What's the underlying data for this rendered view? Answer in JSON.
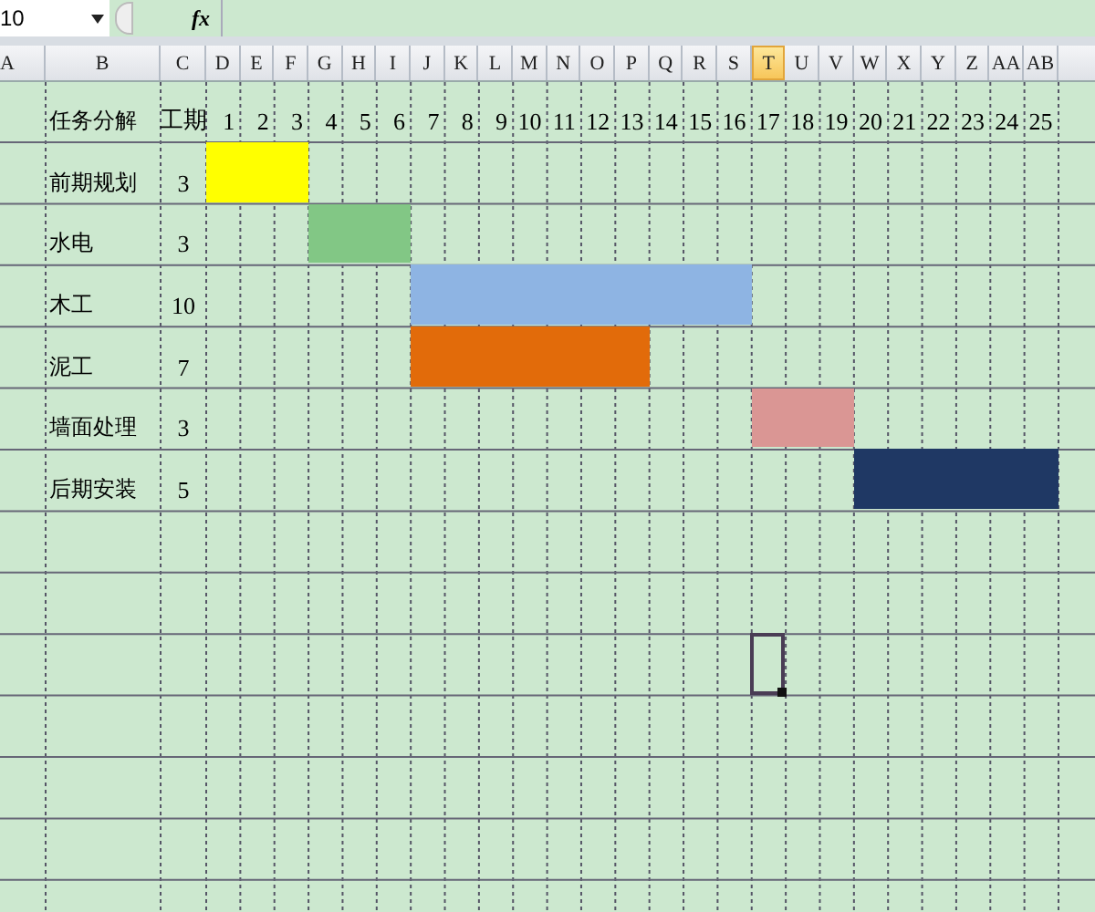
{
  "formula_bar": {
    "name_box": "10",
    "fx": "fx"
  },
  "columns": [
    {
      "label": "A",
      "selected": false
    },
    {
      "label": "B",
      "selected": false
    },
    {
      "label": "C",
      "selected": false
    },
    {
      "label": "D",
      "selected": false
    },
    {
      "label": "E",
      "selected": false
    },
    {
      "label": "F",
      "selected": false
    },
    {
      "label": "G",
      "selected": false
    },
    {
      "label": "H",
      "selected": false
    },
    {
      "label": "I",
      "selected": false
    },
    {
      "label": "J",
      "selected": false
    },
    {
      "label": "K",
      "selected": false
    },
    {
      "label": "L",
      "selected": false
    },
    {
      "label": "M",
      "selected": false
    },
    {
      "label": "N",
      "selected": false
    },
    {
      "label": "O",
      "selected": false
    },
    {
      "label": "P",
      "selected": false
    },
    {
      "label": "Q",
      "selected": false
    },
    {
      "label": "R",
      "selected": false
    },
    {
      "label": "S",
      "selected": false
    },
    {
      "label": "T",
      "selected": true
    },
    {
      "label": "U",
      "selected": false
    },
    {
      "label": "V",
      "selected": false
    },
    {
      "label": "W",
      "selected": false
    },
    {
      "label": "X",
      "selected": false
    },
    {
      "label": "Y",
      "selected": false
    },
    {
      "label": "Z",
      "selected": false
    },
    {
      "label": "AA",
      "selected": false
    },
    {
      "label": "AB",
      "selected": false
    }
  ],
  "header_row": {
    "task": "任务分解",
    "duration": "工期",
    "days": [
      "1",
      "2",
      "3",
      "4",
      "5",
      "6",
      "7",
      "8",
      "9",
      "10",
      "11",
      "12",
      "13",
      "14",
      "15",
      "16",
      "17",
      "18",
      "19",
      "20",
      "21",
      "22",
      "23",
      "24",
      "25"
    ]
  },
  "tasks": [
    {
      "name": "前期规划",
      "duration": "3",
      "color": "#ffff00",
      "filled": [
        true,
        true,
        true,
        false,
        false,
        false,
        false,
        false,
        false,
        false,
        false,
        false,
        false,
        false,
        false,
        false,
        false,
        false,
        false,
        false,
        false,
        false,
        false,
        false,
        false
      ]
    },
    {
      "name": "水电",
      "duration": "3",
      "color": "#82c785",
      "filled": [
        false,
        false,
        false,
        true,
        true,
        true,
        false,
        false,
        false,
        false,
        false,
        false,
        false,
        false,
        false,
        false,
        false,
        false,
        false,
        false,
        false,
        false,
        false,
        false,
        false
      ]
    },
    {
      "name": "木工",
      "duration": "10",
      "color": "#8eb4e3",
      "filled": [
        false,
        false,
        false,
        false,
        false,
        false,
        true,
        true,
        true,
        true,
        true,
        true,
        true,
        true,
        true,
        true,
        false,
        false,
        false,
        false,
        false,
        false,
        false,
        false,
        false
      ]
    },
    {
      "name": "泥工",
      "duration": "7",
      "color": "#e26b0a",
      "filled": [
        false,
        false,
        false,
        false,
        false,
        false,
        true,
        true,
        true,
        true,
        true,
        true,
        true,
        false,
        false,
        false,
        false,
        false,
        false,
        false,
        false,
        false,
        false,
        false,
        false
      ]
    },
    {
      "name": "墙面处理",
      "duration": "3",
      "color": "#da9694",
      "filled": [
        false,
        false,
        false,
        false,
        false,
        false,
        false,
        false,
        false,
        false,
        false,
        false,
        false,
        false,
        false,
        false,
        true,
        true,
        true,
        false,
        false,
        false,
        false,
        false,
        false
      ]
    },
    {
      "name": "后期安装",
      "duration": "5",
      "color": "#1f3864",
      "filled": [
        false,
        false,
        false,
        false,
        false,
        false,
        false,
        false,
        false,
        false,
        false,
        false,
        false,
        false,
        false,
        false,
        false,
        false,
        false,
        true,
        true,
        true,
        true,
        true,
        true
      ]
    }
  ],
  "empty_rows": [
    {
      "selected": false
    },
    {
      "selected": false
    },
    {
      "selected": true
    },
    {
      "selected": false
    },
    {
      "selected": false
    },
    {
      "selected": false
    },
    {
      "selected": false
    }
  ]
}
